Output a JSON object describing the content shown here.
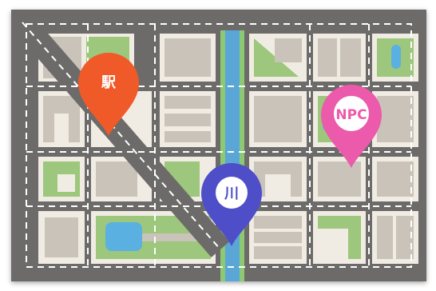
{
  "map": {
    "colors": {
      "road": "#6c6b69",
      "block_bg": "#f1ece3",
      "building": "#c9c3b9",
      "park": "#9cc77c",
      "river": "#5aa7d7",
      "river_bank": "#8dc873",
      "pond": "#5bb0e2",
      "dash": "#ffffff"
    },
    "markers": [
      {
        "id": "station",
        "label": "駅",
        "color": "#f05a28",
        "icon": "map-pin-icon"
      },
      {
        "id": "river",
        "label": "川",
        "color": "#4e4fc8",
        "icon": "map-pin-icon"
      },
      {
        "id": "npc",
        "label": "NPC",
        "color": "#ec5aab",
        "icon": "map-pin-icon"
      }
    ]
  }
}
